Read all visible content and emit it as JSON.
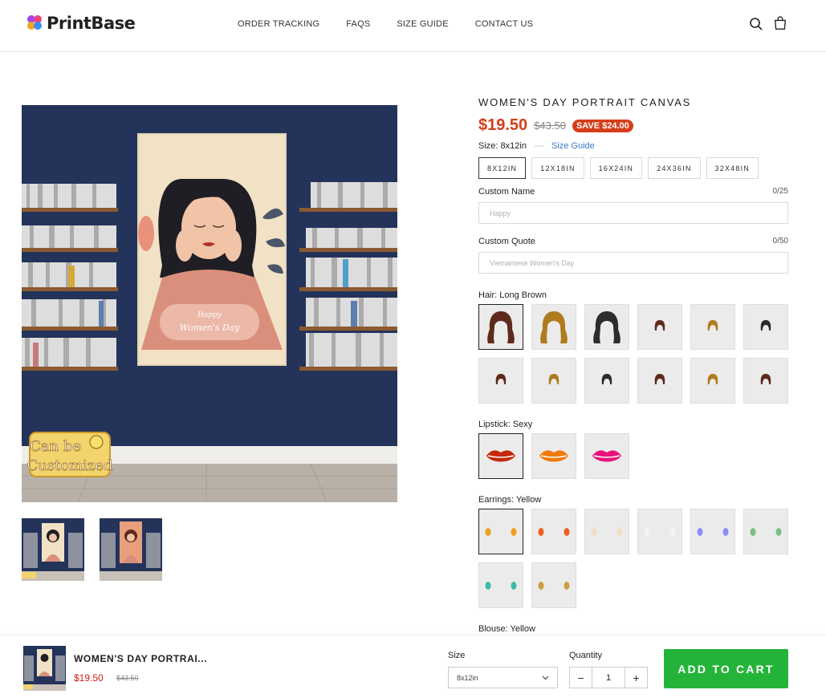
{
  "brand": {
    "name": "PrintBase",
    "dot_colors": [
      "#a446f0",
      "#f0457c",
      "#f2a623",
      "#3a8ff0"
    ]
  },
  "nav": [
    "ORDER TRACKING",
    "FAQS",
    "SIZE GUIDE",
    "CONTACT US"
  ],
  "header_icons": [
    "search-icon",
    "cart-icon"
  ],
  "gallery": {
    "badge_line1": "Can be",
    "badge_line2": "Customized",
    "canvas_text_1": "Happy",
    "canvas_text_2": "Women's Day"
  },
  "product": {
    "title": "WOMEN'S DAY PORTRAIT CANVAS",
    "price": "$19.50",
    "compare_price": "$43.50",
    "save": "SAVE $24.00",
    "size_label": "Size:",
    "size_value": "8x12in",
    "size_guide": "Size Guide",
    "sizes": [
      "8X12IN",
      "12X18IN",
      "16X24IN",
      "24X36IN",
      "32X48IN"
    ],
    "selected_size": 0,
    "custom_name": {
      "label": "Custom Name",
      "counter": "0/25",
      "placeholder": "Happy"
    },
    "custom_quote": {
      "label": "Custom Quote",
      "counter": "0/50",
      "placeholder": "Vietnamese Women's Day"
    },
    "hair": {
      "label": "Hair: Long Brown"
    },
    "lipstick": {
      "label": "Lipstick: Sexy"
    },
    "earrings": {
      "label": "Earrings: Yellow"
    },
    "blouse": {
      "label": "Blouse: Yellow"
    }
  },
  "hair_colors": [
    "#5e2a1c",
    "#b07a1e",
    "#2c2c2c",
    "#5e2a1c",
    "#b07a1e",
    "#2c2c2c",
    "#5e2a1c",
    "#b07a1e",
    "#2c2c2c",
    "#5e2a1c",
    "#b07a1e",
    "#5e2a1c"
  ],
  "lip_colors": [
    "#c5280a",
    "#f17a0c",
    "#e8147c"
  ],
  "earring_colors": [
    "#f0a020",
    "#f06020",
    "#f2dcc8",
    "#f4f4f4",
    "#8a8ff5",
    "#7cbf85",
    "#40b8a8",
    "#c9a040"
  ],
  "sticky": {
    "name": "WOMEN'S DAY PORTRAI...",
    "price": "$19.50",
    "compare": "$43.50",
    "size_label": "Size",
    "size_value": "8x12in",
    "qty_label": "Quantity",
    "qty_value": "1",
    "minus": "−",
    "plus": "+",
    "cta": "ADD TO CART"
  }
}
